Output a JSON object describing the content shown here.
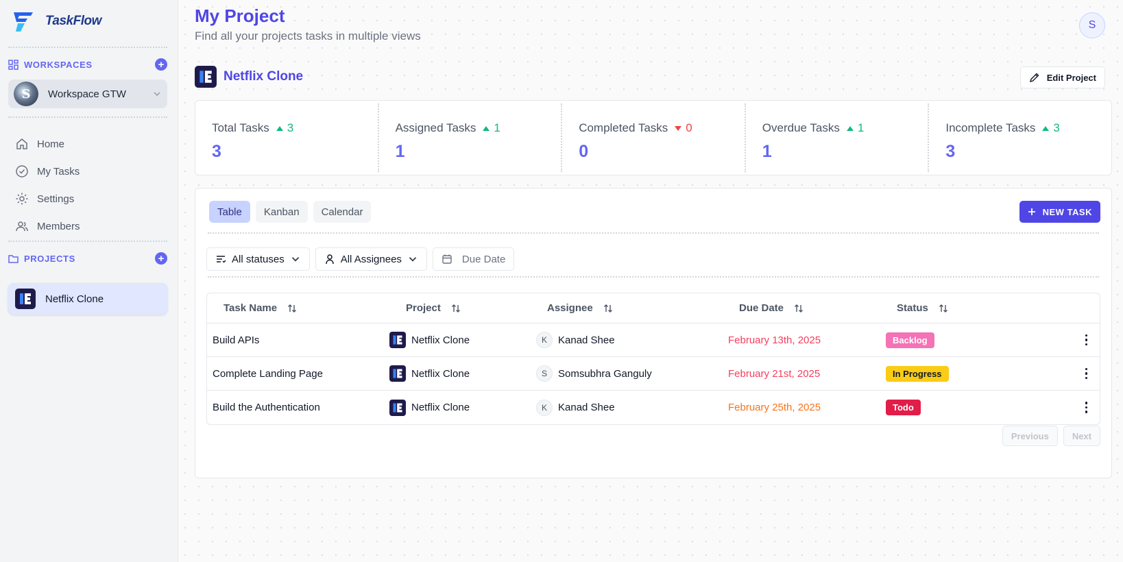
{
  "app": {
    "name": "TaskFlow"
  },
  "sidebar": {
    "workspaces_label": "WORKSPACES",
    "workspace": {
      "name": "Workspace GTW",
      "avatar_letter": "S"
    },
    "nav": [
      {
        "label": "Home",
        "icon": "home-icon"
      },
      {
        "label": "My Tasks",
        "icon": "check-circle-icon"
      },
      {
        "label": "Settings",
        "icon": "gear-icon"
      },
      {
        "label": "Members",
        "icon": "users-icon"
      }
    ],
    "projects_label": "PROJECTS",
    "projects": [
      {
        "name": "Netflix Clone"
      }
    ]
  },
  "header": {
    "title": "My Project",
    "subtitle": "Find all your projects tasks in multiple views",
    "user_initial": "S"
  },
  "project": {
    "name": "Netflix Clone",
    "edit_label": "Edit Project"
  },
  "stats": [
    {
      "label": "Total Tasks",
      "change": "3",
      "direction": "up",
      "value": "3"
    },
    {
      "label": "Assigned Tasks",
      "change": "1",
      "direction": "up",
      "value": "1"
    },
    {
      "label": "Completed Tasks",
      "change": "0",
      "direction": "down",
      "value": "0"
    },
    {
      "label": "Overdue Tasks",
      "change": "1",
      "direction": "up",
      "value": "1"
    },
    {
      "label": "Incomplete Tasks",
      "change": "3",
      "direction": "up",
      "value": "3"
    }
  ],
  "views": {
    "tabs": [
      "Table",
      "Kanban",
      "Calendar"
    ],
    "active": "Table",
    "new_task_label": "NEW TASK"
  },
  "filters": {
    "status": "All statuses",
    "assignee": "All Assignees",
    "due_date_placeholder": "Due Date"
  },
  "table": {
    "columns": [
      "Task Name",
      "Project",
      "Assignee",
      "Due Date",
      "Status"
    ],
    "rows": [
      {
        "task": "Build APIs",
        "project": "Netflix Clone",
        "assignee_initial": "K",
        "assignee": "Kanad Shee",
        "due": "February 13th, 2025",
        "due_color": "#f43f5e",
        "status": "Backlog",
        "status_bg": "#f472b6",
        "status_fg": "#ffffff"
      },
      {
        "task": "Complete Landing Page",
        "project": "Netflix Clone",
        "assignee_initial": "S",
        "assignee": "Somsubhra Ganguly",
        "due": "February 21st, 2025",
        "due_color": "#f43f5e",
        "status": "In Progress",
        "status_bg": "#facc15",
        "status_fg": "#111827"
      },
      {
        "task": "Build the Authentication",
        "project": "Netflix Clone",
        "assignee_initial": "K",
        "assignee": "Kanad Shee",
        "due": "February 25th, 2025",
        "due_color": "#f97316",
        "status": "Todo",
        "status_bg": "#e11d48",
        "status_fg": "#ffffff"
      }
    ]
  },
  "pagination": {
    "previous": "Previous",
    "next": "Next"
  },
  "colors": {
    "accent": "#4f46e5",
    "accent_light": "#6366f1",
    "positive": "#10b981",
    "negative": "#ef4444"
  }
}
